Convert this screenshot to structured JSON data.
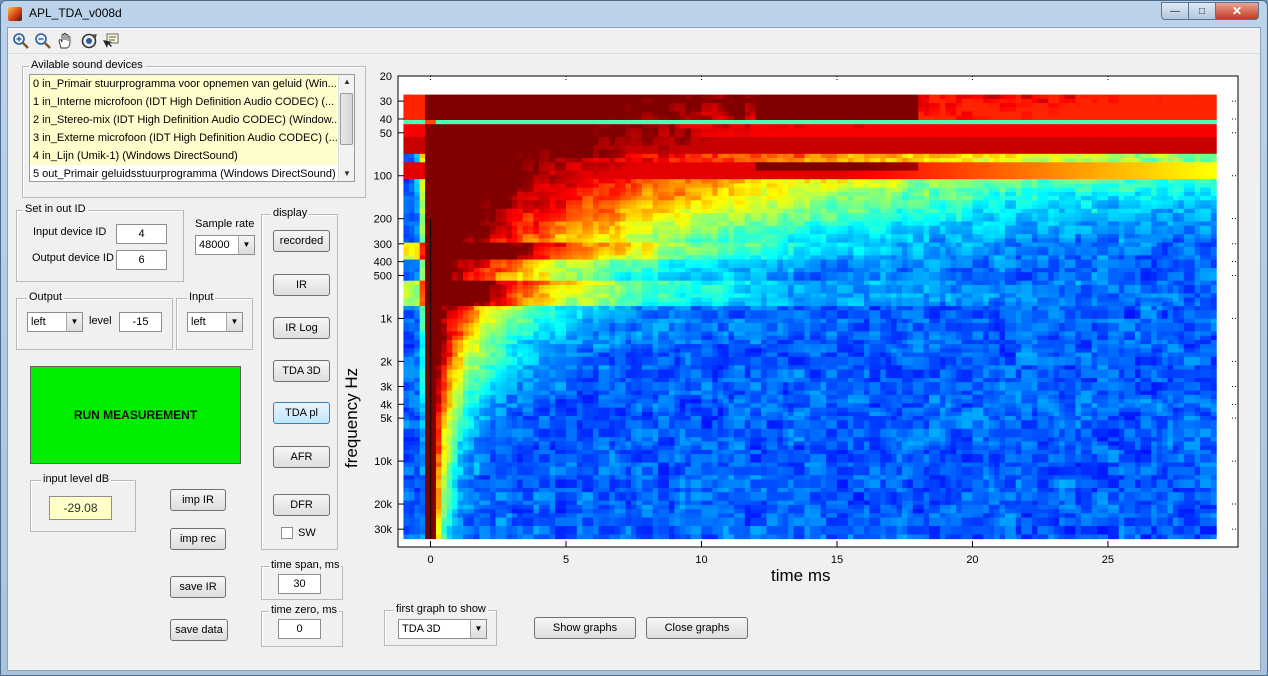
{
  "window": {
    "title": "APL_TDA_v008d",
    "minimize": "—",
    "maximize": "□",
    "close": "✕"
  },
  "toolbar": {
    "icons": [
      "zoom-in-icon",
      "zoom-out-icon",
      "pan-hand-icon",
      "rotate-3d-icon",
      "data-cursor-icon"
    ]
  },
  "devices": {
    "title": "Avilable sound devices",
    "items": [
      "0 in_Primair stuurprogramma voor opnemen van geluid (Win...",
      "1 in_Interne microfoon (IDT High Definition Audio CODEC) (...",
      "2 in_Stereo-mix (IDT High Definition Audio CODEC) (Window...",
      "3 in_Externe microfoon (IDT High Definition Audio CODEC) (...",
      "4 in_Lijn (Umik-1) (Windows DirectSound)",
      "5 out_Primair geluidsstuurprogramma (Windows DirectSound)"
    ]
  },
  "inout": {
    "title": "Set in out ID",
    "input_label": "Input device ID",
    "input_value": "4",
    "output_label": "Output device ID",
    "output_value": "6"
  },
  "sample_rate": {
    "label": "Sample rate",
    "value": "48000"
  },
  "output": {
    "title": "Output",
    "channel": "left",
    "level_label": "level",
    "level_value": "-15"
  },
  "input": {
    "title": "Input",
    "channel": "left"
  },
  "run_label": "RUN MEASUREMENT",
  "input_level": {
    "title": "input level dB",
    "value": "-29.08"
  },
  "actions": {
    "imp_ir": "imp IR",
    "imp_rec": "imp rec",
    "save_ir": "save IR",
    "save_data": "save data"
  },
  "display": {
    "title": "display",
    "buttons": [
      "recorded",
      "IR",
      "IR Log",
      "TDA 3D",
      "TDA pl",
      "AFR",
      "DFR"
    ],
    "active": "TDA pl",
    "sw_label": "SW"
  },
  "time_span": {
    "title": "time span, ms",
    "value": "30"
  },
  "time_zero": {
    "title": "time zero, ms",
    "value": "0"
  },
  "first_graph": {
    "title": "first graph to show",
    "value": "TDA 3D"
  },
  "show_graphs": "Show graphs",
  "close_graphs": "Close graphs",
  "chart_data": {
    "type": "heatmap",
    "xlabel": "time   ms",
    "ylabel": "frequency   Hz",
    "x_ticks": [
      0,
      5,
      10,
      15,
      20,
      25
    ],
    "xlim": [
      -1.2,
      29.8
    ],
    "y_ticks": [
      20,
      30,
      40,
      50,
      100,
      200,
      300,
      400,
      500,
      1000,
      2000,
      3000,
      4000,
      5000,
      10000,
      20000,
      30000
    ],
    "y_tick_labels": [
      "20",
      "30",
      "40",
      "50",
      "100",
      "200",
      "300",
      "400",
      "500",
      "1k",
      "2k",
      "3k",
      "4k",
      "5k",
      "10k",
      "20k",
      "30k"
    ],
    "ylim": [
      20,
      40000
    ],
    "y_scale": "log",
    "y_direction": "down",
    "data_time_range": [
      -1,
      29
    ],
    "data_freq_range": [
      27,
      35000
    ],
    "colormap": "jet",
    "grid": false
  },
  "colors": {
    "run_green": "#00ee00",
    "background": "#f0f0f0",
    "input_level_bg": "#ffffc8"
  }
}
